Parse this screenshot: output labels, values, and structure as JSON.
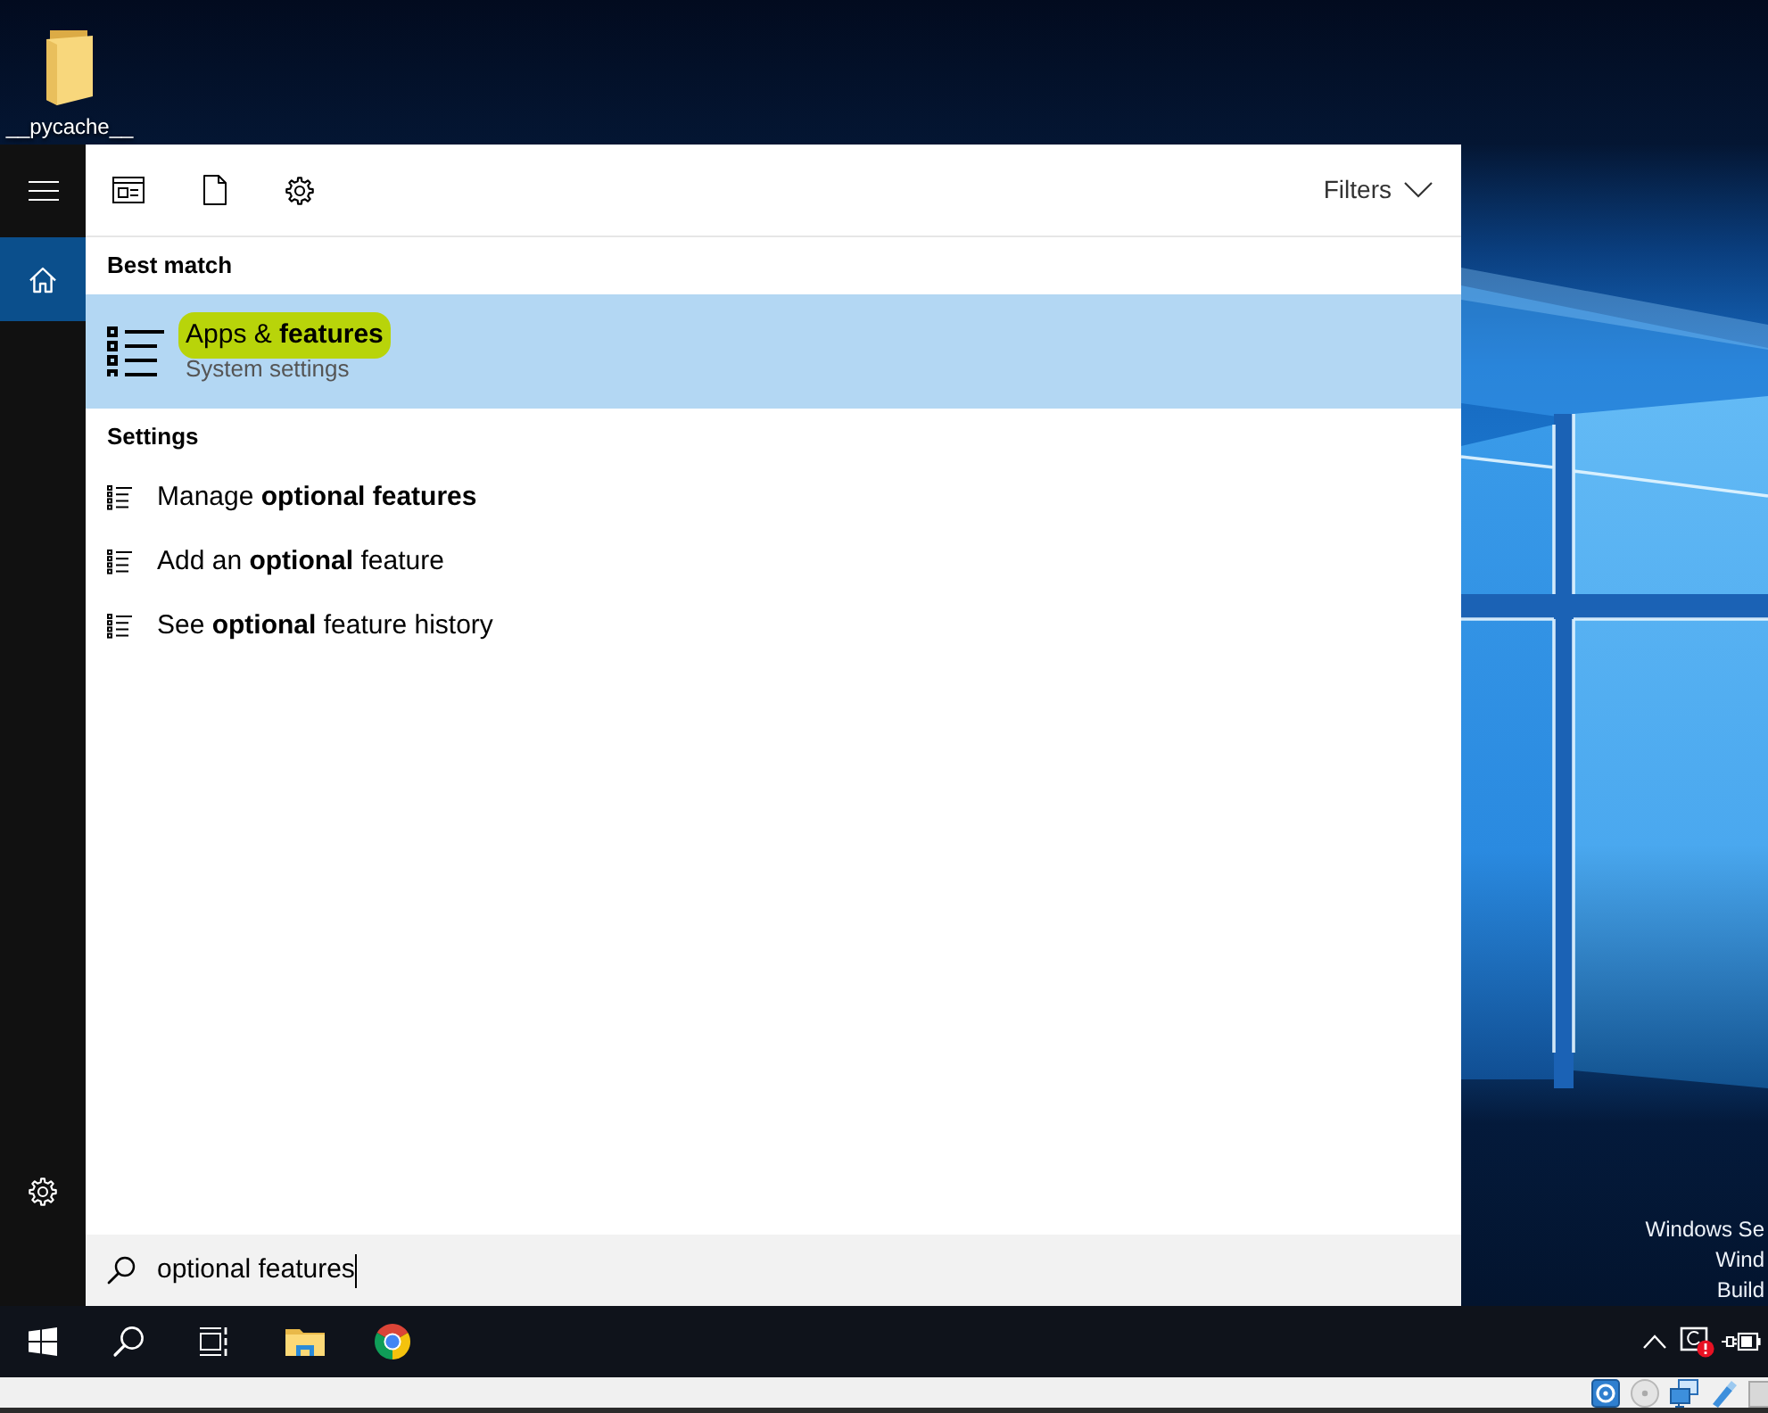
{
  "desktop": {
    "shortcuts": [
      {
        "label": "__pycache__"
      }
    ],
    "edition_text": [
      "Windows Se",
      "Wind",
      "Build"
    ]
  },
  "start_panel": {
    "rail": [
      {
        "kind": "menu",
        "selected": false
      },
      {
        "kind": "home",
        "selected": true
      },
      {
        "kind": "settings",
        "selected": false
      }
    ],
    "scope_buttons": [
      {
        "kind": "apps"
      },
      {
        "kind": "documents"
      },
      {
        "kind": "settings"
      }
    ],
    "filters": "Filters",
    "sections": [
      {
        "heading": "Best match",
        "results": [
          {
            "kind": "top_hit",
            "title": "Apps & **features**",
            "subtitle": "System settings",
            "selected": true,
            "marked": true
          }
        ]
      },
      {
        "heading": "Settings",
        "results": [
          {
            "kind": "setting",
            "title": "Manage **optional features**",
            "selected": false
          },
          {
            "kind": "setting",
            "title": "Add an **optional** feature",
            "selected": false
          },
          {
            "kind": "setting",
            "title": "See **optional** feature history",
            "selected": false
          }
        ]
      }
    ],
    "search": {
      "value": "optional features"
    }
  },
  "taskbar": {
    "buttons": [
      {
        "kind": "start"
      },
      {
        "kind": "search"
      },
      {
        "kind": "task_view"
      },
      {
        "kind": "file_explorer"
      },
      {
        "kind": "browser"
      }
    ],
    "tray": [
      {
        "kind": "show_hidden"
      },
      {
        "kind": "screen",
        "alert": true
      },
      {
        "kind": "power"
      }
    ]
  },
  "vm_status_bar": {
    "devices": [
      {
        "kind": "hard_disk"
      },
      {
        "kind": "optical_drive"
      },
      {
        "kind": "network"
      },
      {
        "kind": "usb"
      },
      {
        "kind": "shared_folders"
      }
    ]
  }
}
